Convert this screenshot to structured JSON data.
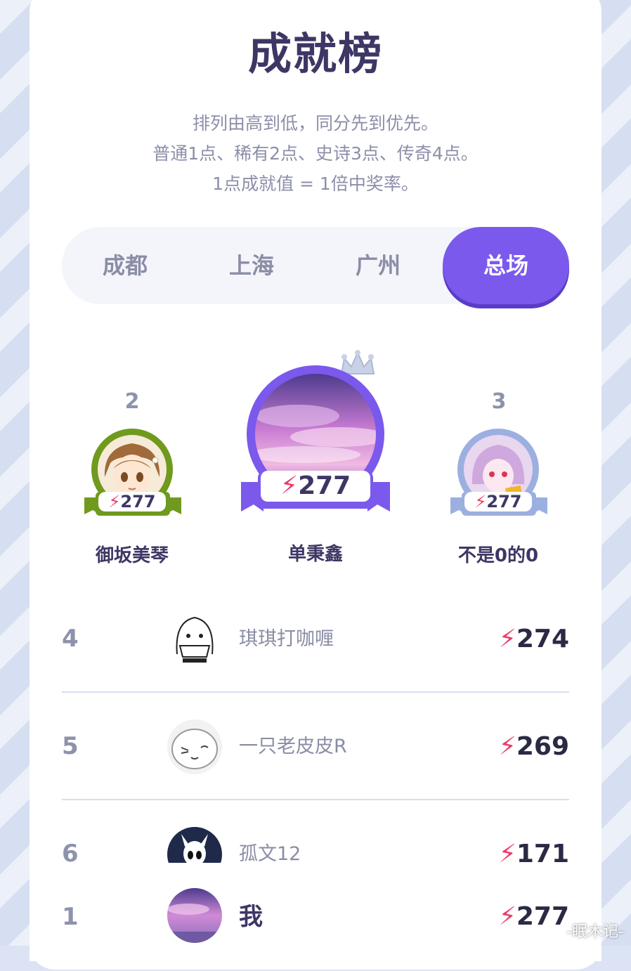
{
  "header": {
    "title": "成就榜",
    "rules": [
      "排列由高到低，同分先到优先。",
      "普通1点、稀有2点、史诗3点、传奇4点。",
      "1点成就值 = 1倍中奖率。"
    ]
  },
  "tabs": [
    {
      "label": "成都",
      "active": false
    },
    {
      "label": "上海",
      "active": false
    },
    {
      "label": "广州",
      "active": false
    },
    {
      "label": "总场",
      "active": true
    }
  ],
  "podium": {
    "first": {
      "rank": "1",
      "name": "单秉鑫",
      "score": "277",
      "ring_color": "#7b59ec"
    },
    "second": {
      "rank": "2",
      "name": "御坂美琴",
      "score": "277",
      "ring_color": "#6f9a1e"
    },
    "third": {
      "rank": "3",
      "name": "不是0的0",
      "score": "277",
      "ring_color": "#9bb0e0"
    }
  },
  "list": [
    {
      "rank": "4",
      "name": "琪琪打咖喱",
      "score": "274"
    },
    {
      "rank": "5",
      "name": "一只老皮皮R",
      "score": "269"
    },
    {
      "rank": "6",
      "name": "孤文12",
      "score": "171"
    }
  ],
  "me": {
    "rank": "1",
    "name": "我",
    "score": "277"
  },
  "icons": {
    "score": "lightning-icon",
    "crown": "crown-icon"
  },
  "colors": {
    "accent": "#7b59ec",
    "bolt": "#ee3a6b",
    "title": "#3d3765"
  },
  "watermark": "-眠木记-"
}
